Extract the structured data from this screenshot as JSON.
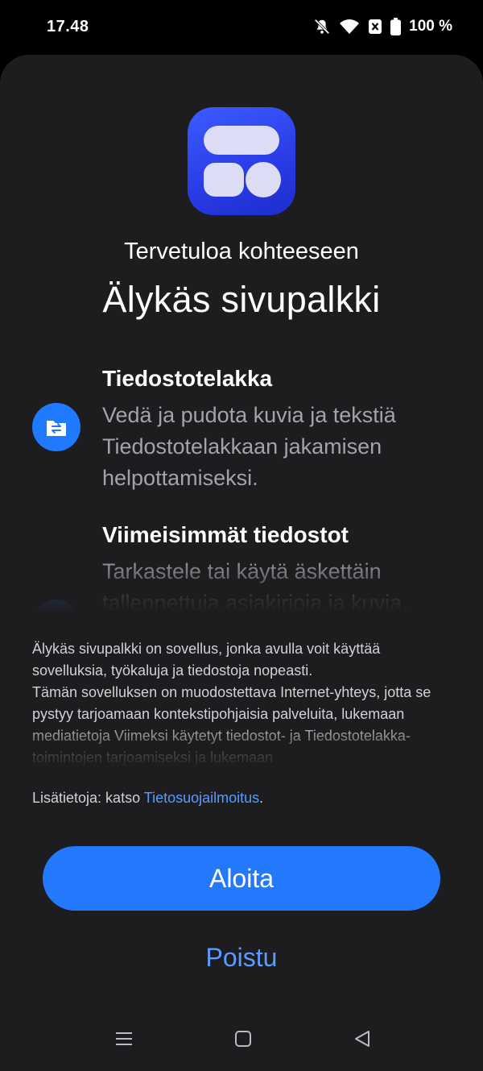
{
  "status_bar": {
    "time": "17.48",
    "battery": "100 %",
    "icons": [
      "bell-muted-icon",
      "wifi-icon",
      "notification-x-icon",
      "battery-icon"
    ]
  },
  "app": {
    "icon": "smart-sidebar-app-icon",
    "welcome": "Tervetuloa kohteeseen",
    "title": "Älykäs sivupalkki"
  },
  "features": [
    {
      "icon": "file-dock-icon",
      "title": "Tiedostotelakka",
      "description": "Vedä ja pudota kuvia ja tekstiä Tiedostotelakkaan jakamisen helpottamiseksi."
    },
    {
      "icon": "recent-files-icon",
      "title": "Viimeisimmät tiedostot",
      "description": "Tarkastele tai käytä äskettäin tallennettuja asiakirjoja ja kuvia."
    }
  ],
  "info": {
    "line1": "Älykäs sivupalkki on sovellus, jonka avulla voit käyttää sovelluksia, työkaluja ja tiedostoja nopeasti.",
    "line2": "Tämän sovelluksen on muodostettava Internet-yhteys, jotta se pystyy tarjoamaan kontekstipohjaisia palveluita, lukemaan mediatietoja Viimeksi käytetyt tiedostot- ja Tiedostotelakka-toimintojen tarjoamiseksi ja lukemaan"
  },
  "more_info": {
    "prefix": "Lisätietoja: katso ",
    "link": "Tietosuojailmoitus",
    "suffix": "."
  },
  "buttons": {
    "start": "Aloita",
    "exit": "Poistu"
  },
  "nav": [
    "menu-icon",
    "home-icon",
    "back-icon"
  ],
  "colors": {
    "background": "#1d1d1f",
    "accent": "#2378fb",
    "link": "#5a9bff"
  }
}
